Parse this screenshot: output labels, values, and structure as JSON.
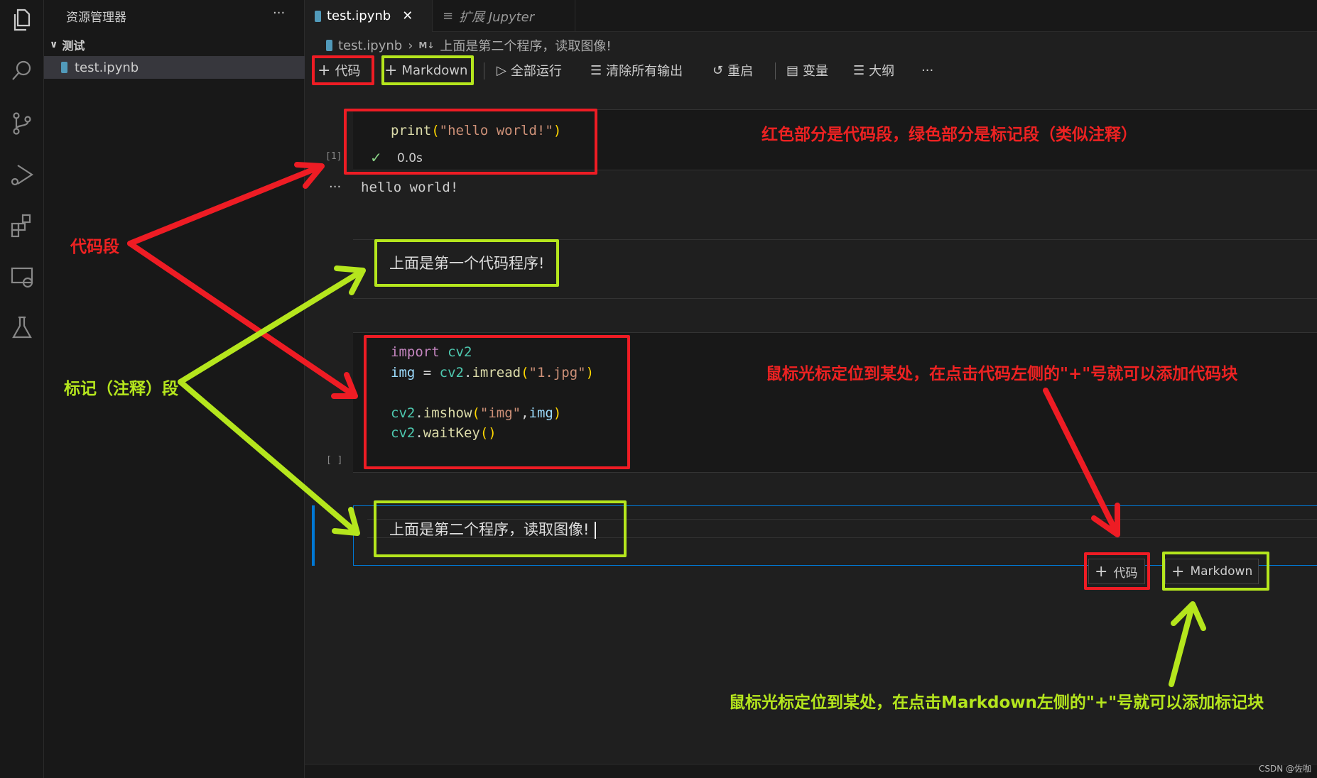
{
  "activity_bar": {
    "icons": [
      "explorer-icon",
      "search-icon",
      "source-control-icon",
      "run-debug-icon",
      "extensions-icon",
      "remote-explorer-icon",
      "testing-icon"
    ]
  },
  "sidebar": {
    "title": "资源管理器",
    "more": "···",
    "folder": "测试",
    "files": [
      {
        "name": "test.ipynb",
        "selected": true
      }
    ]
  },
  "tabs": [
    {
      "label": "test.ipynb",
      "close": "✕",
      "active": true
    },
    {
      "label": "扩展 Jupyter",
      "active": false
    }
  ],
  "breadcrumb": {
    "file": "test.ipynb",
    "sep": "›",
    "badge": "M↓",
    "cell": "上面是第二个程序，读取图像!"
  },
  "toolbar": {
    "add_code": "代码",
    "add_markdown": "Markdown",
    "run_all": "全部运行",
    "clear_outputs": "清除所有输出",
    "restart": "重启",
    "variables": "变量",
    "outline": "大纲",
    "more": "···"
  },
  "cells": [
    {
      "type": "code",
      "exec": "[1]",
      "lines": [
        [
          [
            "fn",
            "print"
          ],
          [
            "br",
            "("
          ],
          [
            "str",
            "\"hello world!\""
          ],
          [
            "br",
            ")"
          ]
        ]
      ],
      "status_icon": "check-icon",
      "time": "0.0s",
      "output_marker": "···",
      "output": "hello world!"
    },
    {
      "type": "markdown",
      "text": "上面是第一个代码程序!"
    },
    {
      "type": "code",
      "exec": "[ ]",
      "lines": [
        [
          [
            "kw",
            "import"
          ],
          [
            "pl",
            " "
          ],
          [
            "mod",
            "cv2"
          ]
        ],
        [
          [
            "var",
            "img"
          ],
          [
            "pl",
            " = "
          ],
          [
            "mod",
            "cv2"
          ],
          [
            "pl",
            "."
          ],
          [
            "fn",
            "imread"
          ],
          [
            "br",
            "("
          ],
          [
            "str",
            "\"1.jpg\""
          ],
          [
            "br",
            ")"
          ]
        ],
        [],
        [
          [
            "mod",
            "cv2"
          ],
          [
            "pl",
            "."
          ],
          [
            "fn",
            "imshow"
          ],
          [
            "br",
            "("
          ],
          [
            "str",
            "\"img\""
          ],
          [
            "pl",
            ","
          ],
          [
            "var",
            "img"
          ],
          [
            "br",
            ")"
          ]
        ],
        [
          [
            "mod",
            "cv2"
          ],
          [
            "pl",
            "."
          ],
          [
            "fn",
            "waitKey"
          ],
          [
            "br",
            "()"
          ]
        ]
      ]
    },
    {
      "type": "markdown",
      "text": "上面是第二个程序，读取图像!",
      "selected": true
    }
  ],
  "insert_buttons": {
    "code": "代码",
    "markdown": "Markdown"
  },
  "annotations": {
    "top_note": "红色部分是代码段，绿色部分是标记段（类似注释）",
    "code_label": "代码段",
    "markdown_label": "标记（注释）段",
    "code_hint": "鼠标光标定位到某处，在点击代码左侧的\"+\"号就可以添加代码块",
    "markdown_hint": "鼠标光标定位到某处，在点击Markdown左侧的\"+\"号就可以添加标记块"
  },
  "watermark": "CSDN @佐咖",
  "colors": {
    "annotation_red": "#ee1c24",
    "annotation_green": "#b5e61d",
    "focus_blue": "#0078d4"
  }
}
